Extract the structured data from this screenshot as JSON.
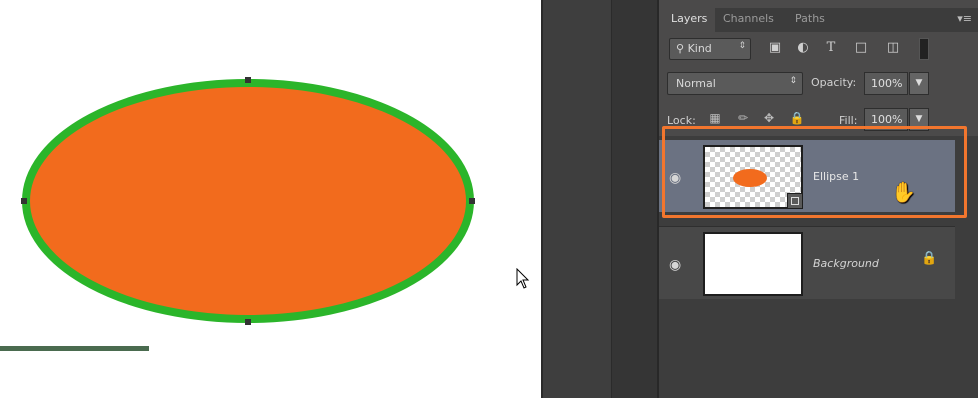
{
  "colors": {
    "ellipse_fill": "#f26b1d",
    "ellipse_stroke": "#2bb52a",
    "highlight": "#f2762e",
    "panel_bg": "#4b4a4a",
    "selected_layer": "#6b7282"
  },
  "canvas": {
    "shape": "ellipse",
    "cursor_icon": "arrow-cursor-icon"
  },
  "layers_panel": {
    "tabs": [
      {
        "label": "Layers",
        "active": true
      },
      {
        "label": "Channels",
        "active": false
      },
      {
        "label": "Paths",
        "active": false
      }
    ],
    "menu_icon": "panel-menu-icon",
    "filter": {
      "kind_label": "Kind",
      "icons": [
        "image-filter-icon",
        "adjustment-filter-icon",
        "type-filter-icon",
        "shape-filter-icon",
        "smart-object-filter-icon"
      ]
    },
    "blend_mode": "Normal",
    "opacity_label": "Opacity:",
    "opacity_value": "100%",
    "lock_label": "Lock:",
    "lock_icons": [
      "lock-transparent-icon",
      "lock-paint-icon",
      "lock-move-icon",
      "lock-all-icon"
    ],
    "fill_label": "Fill:",
    "fill_value": "100%",
    "layers": [
      {
        "name": "Ellipse 1",
        "visible": true,
        "selected": true,
        "type": "shape"
      },
      {
        "name": "Background",
        "visible": true,
        "selected": false,
        "locked": true
      }
    ]
  }
}
